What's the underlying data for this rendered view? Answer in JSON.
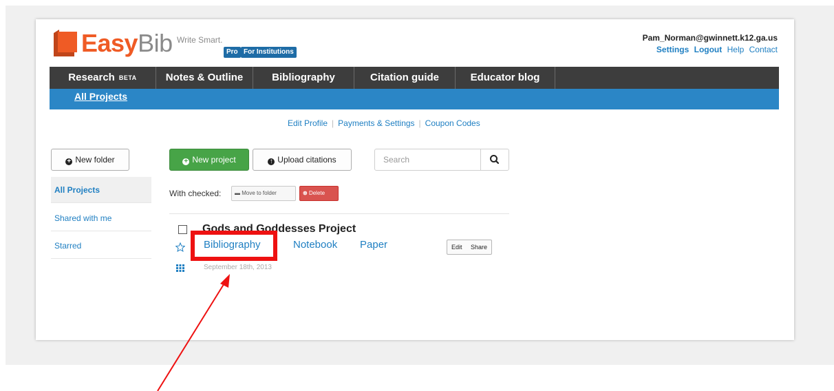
{
  "header": {
    "logo_easy": "Easy",
    "logo_bib": "Bib",
    "tagline": "Write Smart.",
    "badge_pro": "Pro",
    "badge_institutions": "For Institutions",
    "user_email": "Pam_Norman@gwinnett.k12.ga.us",
    "links": {
      "settings": "Settings",
      "logout": "Logout",
      "help": "Help",
      "contact": "Contact"
    }
  },
  "nav": {
    "items": [
      {
        "label": "Research",
        "badge": "BETA"
      },
      {
        "label": "Notes & Outline"
      },
      {
        "label": "Bibliography"
      },
      {
        "label": "Citation guide"
      },
      {
        "label": "Educator blog"
      }
    ],
    "subnav_label": "All Projects"
  },
  "profile_links": {
    "edit_profile": "Edit Profile",
    "payments": "Payments & Settings",
    "coupons": "Coupon Codes"
  },
  "sidebar": {
    "new_folder": "New folder",
    "items": [
      {
        "label": "All Projects",
        "active": true
      },
      {
        "label": "Shared with me"
      },
      {
        "label": "Starred"
      }
    ]
  },
  "toolbar": {
    "new_project": "New project",
    "upload_citations": "Upload citations",
    "search_placeholder": "Search",
    "with_checked": "With checked:",
    "move_to_folder": "Move to folder",
    "delete": "Delete"
  },
  "project": {
    "title": "Gods and Goddesses Project",
    "links": [
      "Bibliography",
      "Notebook",
      "Paper"
    ],
    "date": "September 18th, 2013",
    "edit": "Edit",
    "share": "Share"
  },
  "colors": {
    "brand_orange": "#ef5b25",
    "nav_dark": "#3d3d3d",
    "subnav_blue": "#2b86c6",
    "link_blue": "#1f7fc2",
    "green": "#47a447",
    "delete_red": "#d9534f",
    "annotation_red": "#ee1111"
  }
}
